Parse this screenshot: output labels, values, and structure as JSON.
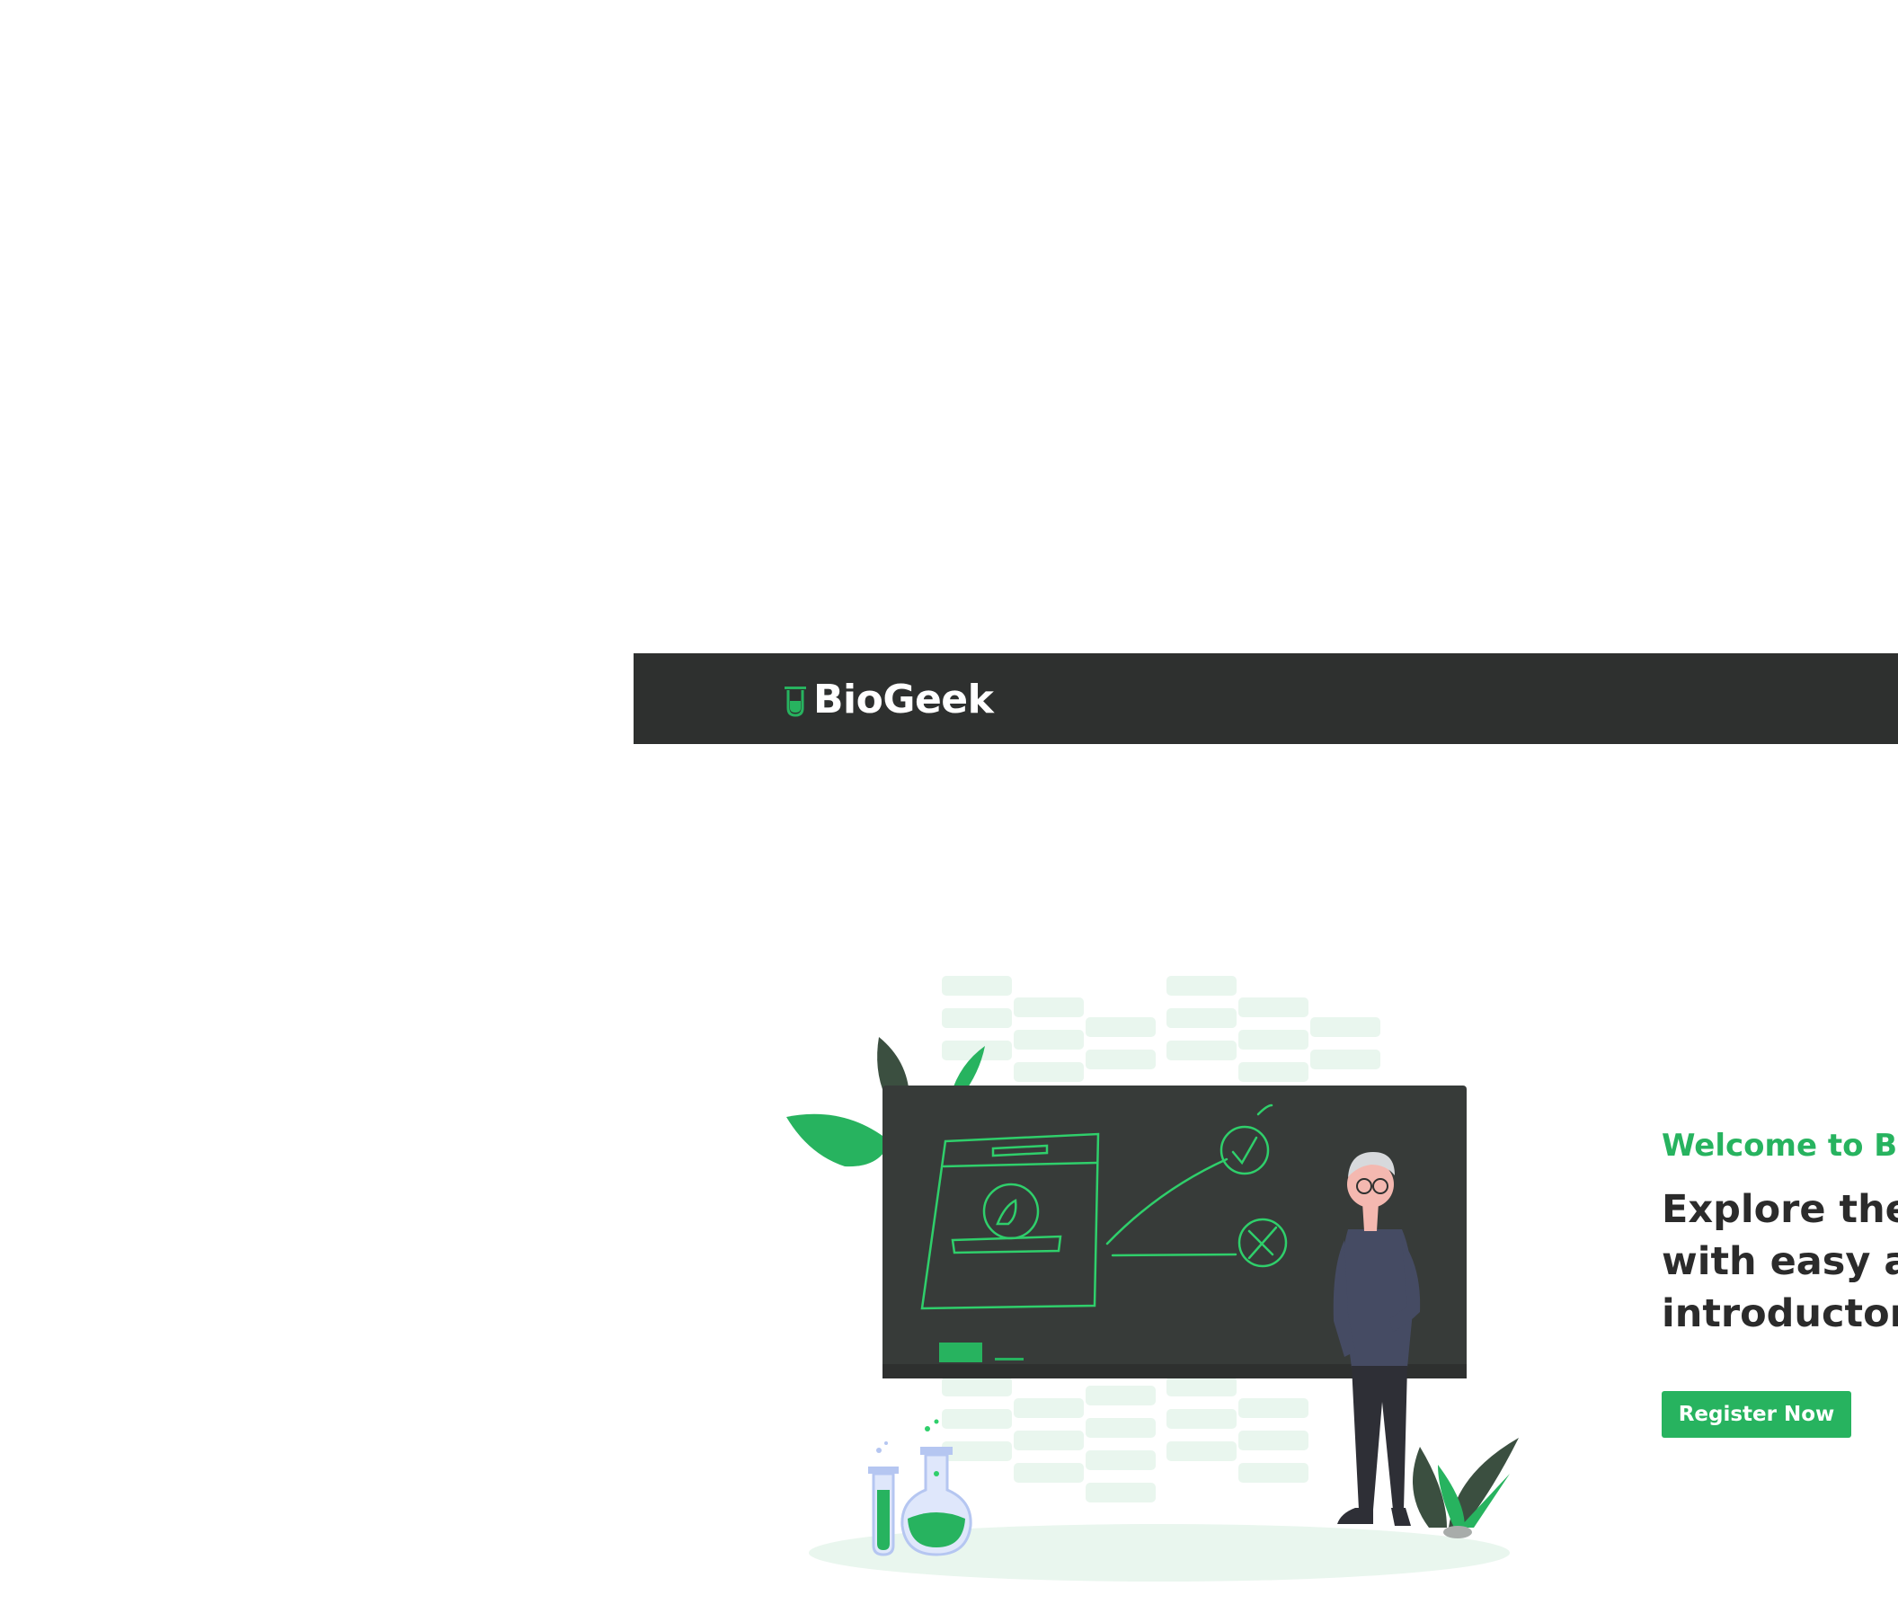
{
  "brand": {
    "name": "BioGeek",
    "accent_color": "#27b35f",
    "navbar_color": "#2e302f"
  },
  "hero": {
    "welcome": "Welcome to Bi",
    "headline_lines": [
      "Explore the w",
      "with easy ar",
      "introductory"
    ],
    "register_label": "Register Now"
  },
  "icons": {
    "logo": "test-tube-leaf-icon",
    "illustration": "teacher-at-chalkboard-illustration"
  }
}
